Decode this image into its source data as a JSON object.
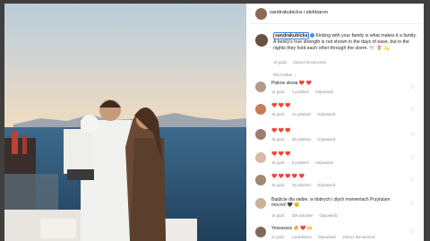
{
  "header": {
    "user": "sandrakubicka",
    "separator": "i",
    "second_user": "alekbaron"
  },
  "post": {
    "caption_user": "sandrakubicka",
    "caption_text": "Kicking with your family is what makes it a family. A family's true strength is not shown in the days of ease, but in the nights they hold each other through the storm. 🕊️ 🌷 💫",
    "time": "15 godz.",
    "see_translation": "Zobacz tłumaczenie"
  },
  "for_you_label": "Dla Ciebie ⌄",
  "comments": [
    {
      "user": "",
      "text": "Piękne słowa",
      "emoji": "❤️ ❤️",
      "time": "14 godz.",
      "likes": "2 polubień",
      "reply": "Odpowiedz",
      "avatar_color": "#b59a86"
    },
    {
      "user": "",
      "text": "",
      "emoji": "❤️ ❤️ ❤️",
      "time": "15 godz.",
      "likes": "41 polubień",
      "reply": "Odpowiedz",
      "avatar_color": "#c87a5a"
    },
    {
      "user": "",
      "text": "",
      "emoji": "❤️ ❤️ ❤️",
      "time": "15 godz.",
      "likes": "35 polubień",
      "reply": "Odpowiedz",
      "avatar_color": "#9a7f6d"
    },
    {
      "user": "",
      "text": "",
      "emoji": "❤️ ❤️ ❤️",
      "time": "15 godz.",
      "likes": "6 polubień",
      "reply": "Odpowiedz",
      "avatar_color": "#d8b8a8"
    },
    {
      "user": "",
      "text": "",
      "emoji": "❤️ ❤️ ❤️ ❤️ ❤️",
      "time": "15 godz.",
      "likes": "16 polubień",
      "reply": "Odpowiedz",
      "avatar_color": "#a08a70"
    },
    {
      "user": "",
      "text": "Bądźcie dla siebie, w dobrych i złych momentach Przytulam mocno!",
      "emoji": "🖤 😊",
      "time": "15 godz.",
      "likes": "208 polubień",
      "reply": "Odpowiedz",
      "avatar_color": "#c9b298"
    },
    {
      "user": "",
      "text": "Yesssssss",
      "emoji": "🔥 ❤️ 🙌",
      "time": "11 godz.",
      "likes": "4 polubienia",
      "reply": "Odpowiedz",
      "see_translation": "Zobacz tłumaczenie",
      "avatar_color": "#7d6a5c"
    }
  ]
}
